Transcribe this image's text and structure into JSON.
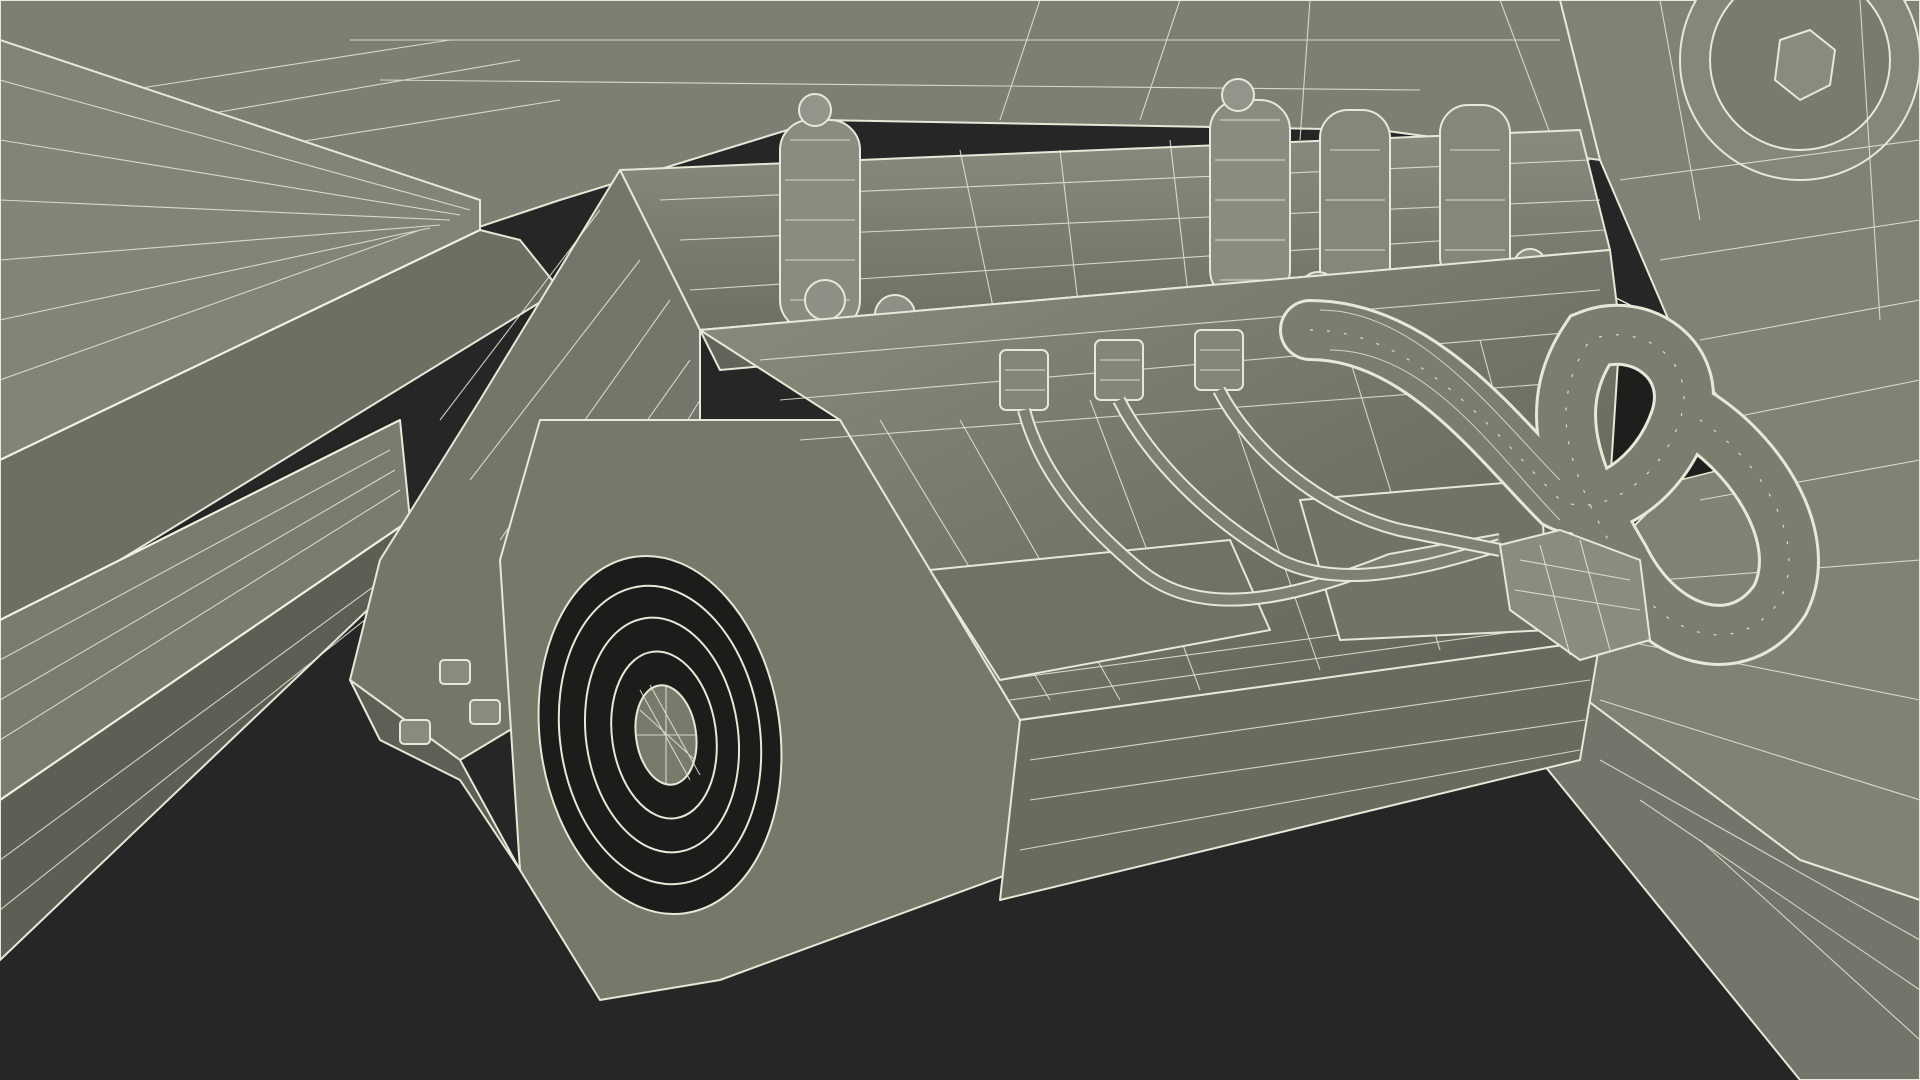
{
  "scene": {
    "kind": "wireframe-render",
    "subject": [
      "fan",
      "cable",
      "connector",
      "bolt"
    ],
    "colors": {
      "background": "#262626",
      "surface": "#7d7e70",
      "surface_shadow": "#5d5e53",
      "surface_light": "#8e8f81",
      "wire": "#e6e8d8"
    }
  }
}
